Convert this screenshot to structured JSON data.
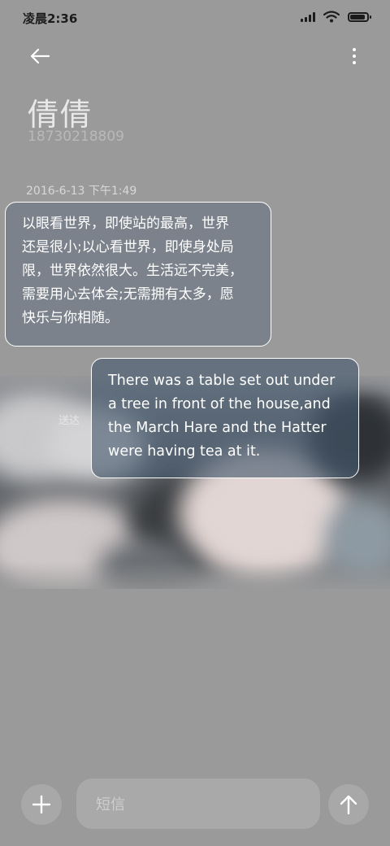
{
  "status_bar": {
    "time": "凌晨2:36",
    "battery_level": 0.9
  },
  "icons": {
    "back": "back-arrow-icon",
    "more": "more-vertical-icon",
    "add": "plus-icon",
    "send": "send-arrow-icon"
  },
  "conversation": {
    "contact_name": "倩倩",
    "phone_number": "18730218809",
    "timestamp": "2016-6-13 下午1:49",
    "messages": [
      {
        "direction": "received",
        "lines": [
          "以眼看世界，即使站的最高，世界",
          "还是很小;以心看世界，即使身处局",
          "限，世界依然很大。生活远不完美，",
          "需要用心去体会;无需拥有太多，愿",
          "快乐与你相随。"
        ]
      },
      {
        "direction": "sent",
        "status": "送达",
        "lines": [
          "There was a table set out under",
          "a tree in front of the house,and",
          "the March Hare and the Hatter",
          "were having tea at it."
        ]
      }
    ]
  },
  "composer": {
    "placeholder": "短信"
  },
  "colors": {
    "background": "#9a9a9a",
    "bubble_border": "#ffffff",
    "received_bubble": "#697584",
    "sent_bubble": "#46586e"
  }
}
